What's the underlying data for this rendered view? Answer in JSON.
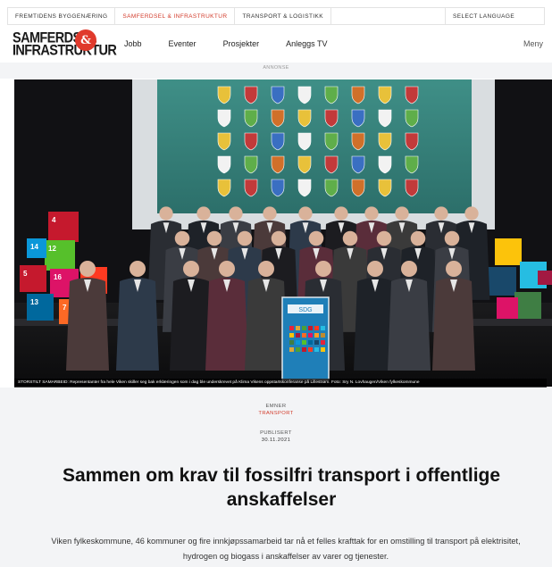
{
  "topbar": {
    "links": [
      {
        "label": "FREMTIDENS BYGGENÆRING",
        "active": false
      },
      {
        "label": "SAMFERDSEL & INFRASTRUKTUR",
        "active": true
      },
      {
        "label": "TRANSPORT & LOGISTIKK",
        "active": false
      }
    ],
    "language": "SELECT LANGUAGE"
  },
  "logo": {
    "line1": "SAMFERDSEL",
    "line2": "INFRASTRUKTUR",
    "amp": "&",
    "color": "#e03a2c"
  },
  "nav": {
    "items": [
      "Jobb",
      "Eventer",
      "Prosjekter",
      "Anleggs TV"
    ],
    "menu": "Meny"
  },
  "ad_label": "ANNONSE",
  "photo": {
    "caption": "STORSTILT SAMARBEID: Representanter fra hele Viken skiller seg bak erklæringen som i dag ble underskrevet på Klima Vikens oppstartskonferanse på Lillestrøm. Foto: Sry N. Lovhaugen/Viken fylkeskommune",
    "banner_text": "SDG",
    "cube_labels": [
      "4",
      "14",
      "12",
      "5",
      "16",
      "13",
      "7"
    ]
  },
  "article": {
    "topic_label": "EMNER",
    "topic": "TRANSPORT",
    "published_label": "PUBLISERT",
    "published_date": "30.11.2021",
    "headline": "Sammen om krav til fossilfri transport i offentlige anskaffelser",
    "lead": "Viken fylkeskommune, 46 kommuner og fire innkjøpssamarbeid tar nå et felles krafttak for en omstilling til transport på elektrisitet, hydrogen og biogass i anskaffelser av varer og tjenester."
  },
  "colors": {
    "accent": "#d23a2a",
    "background": "#f3f4f6"
  }
}
